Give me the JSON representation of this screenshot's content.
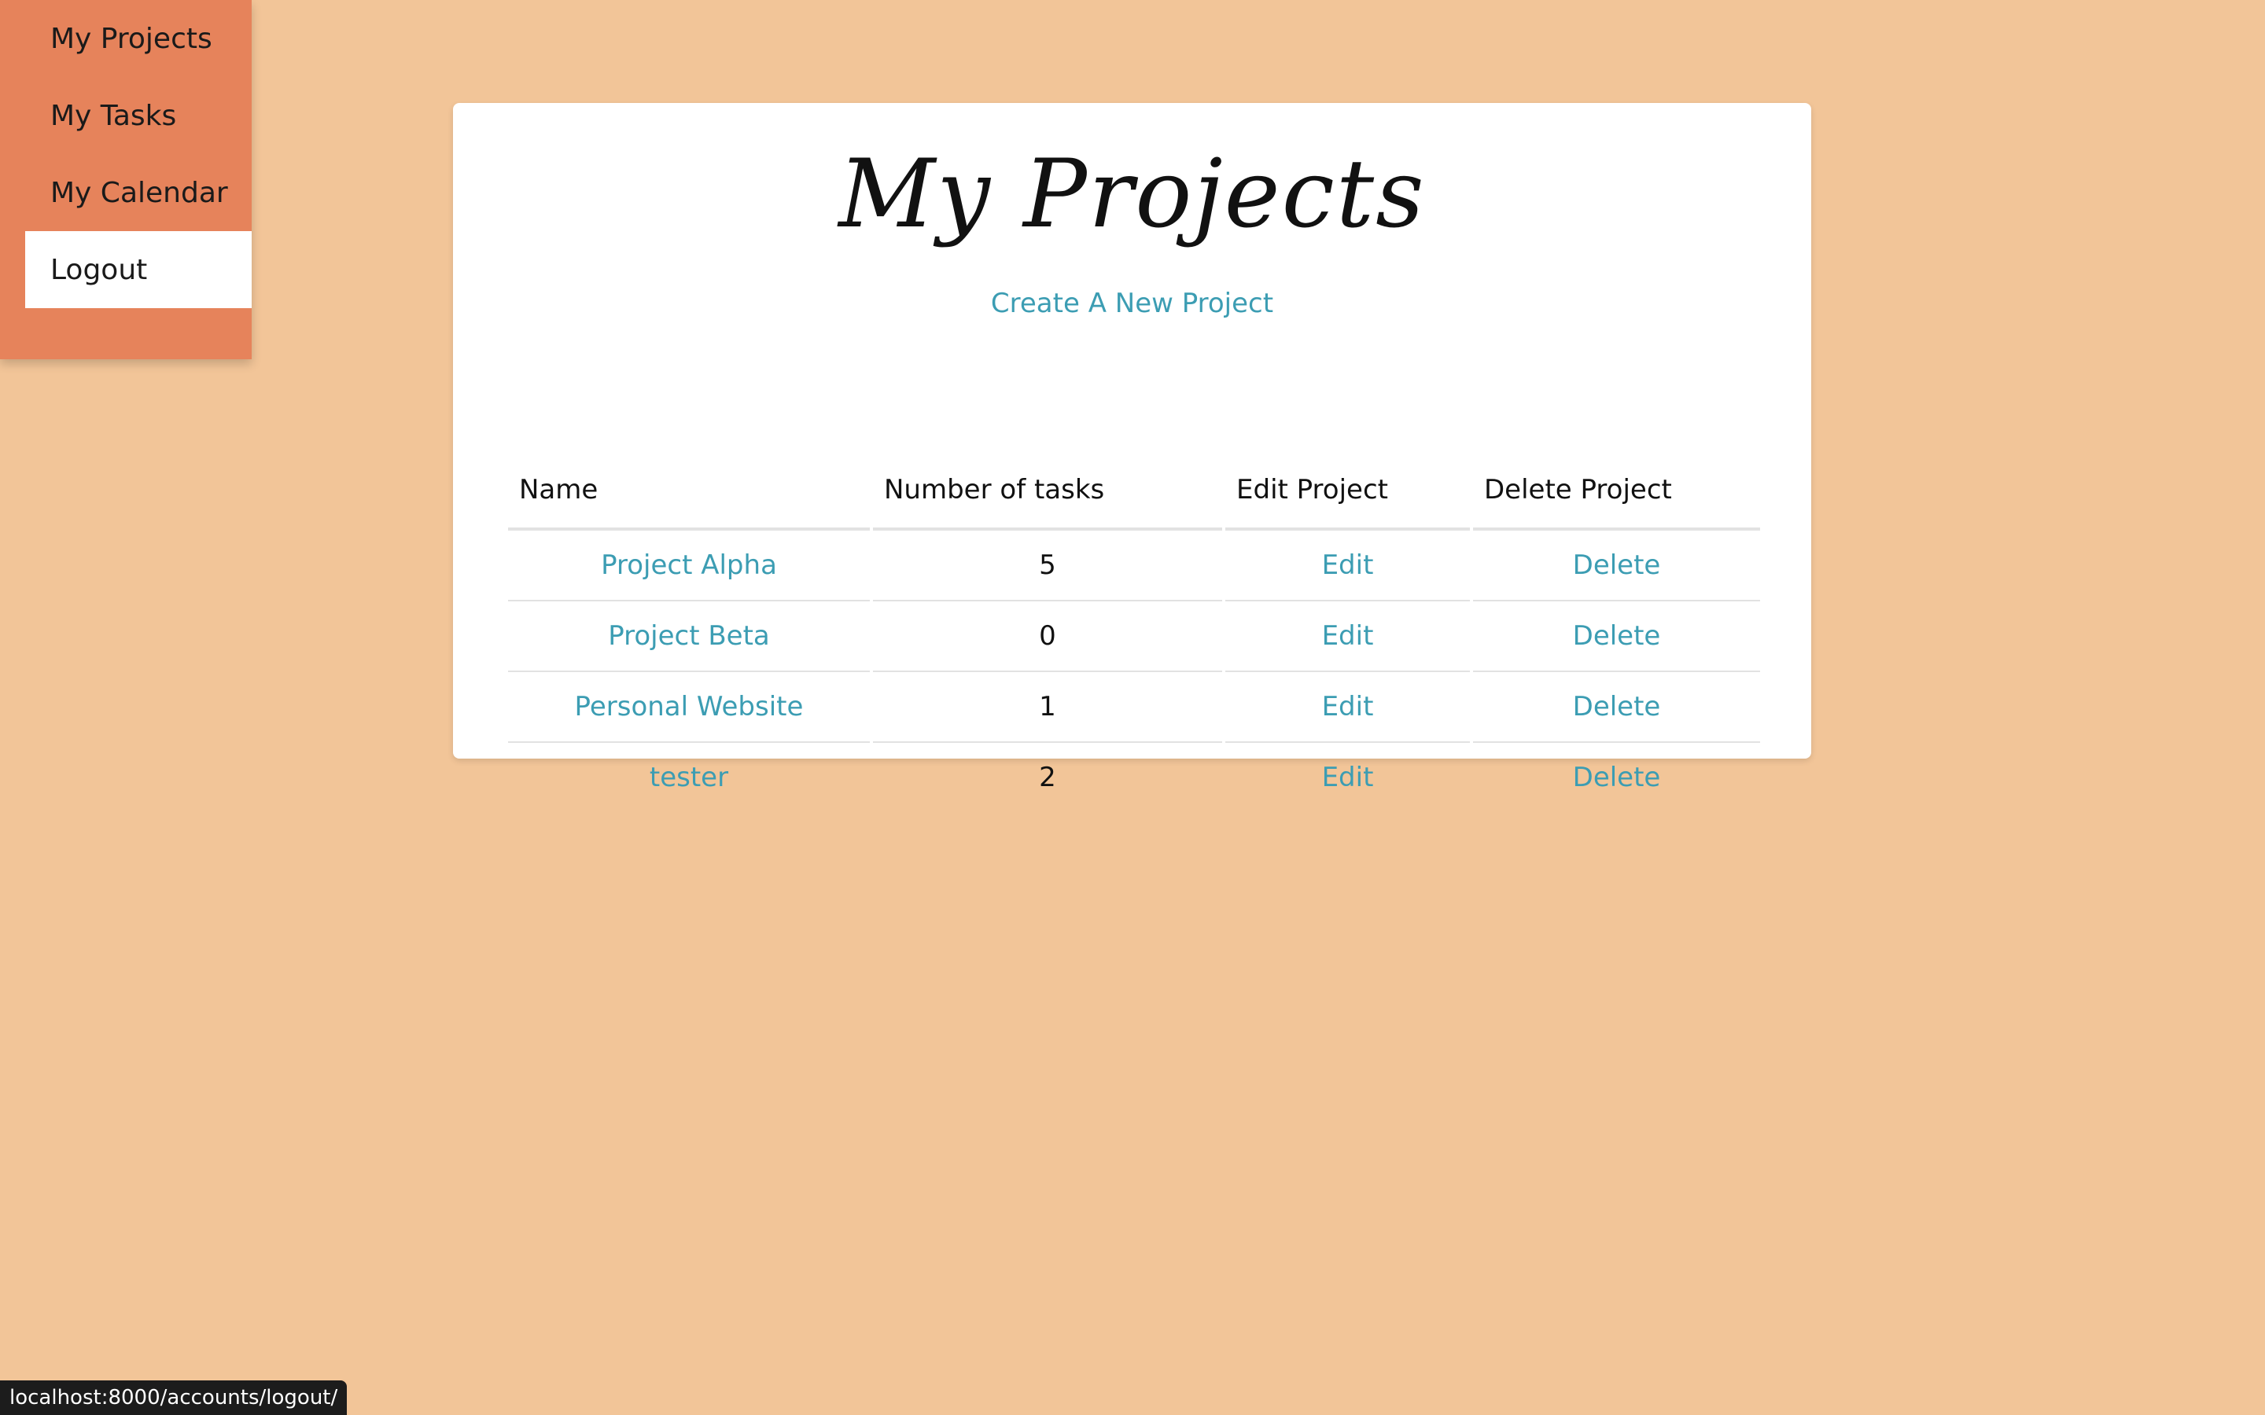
{
  "sidebar": {
    "items": [
      {
        "label": "My Projects"
      },
      {
        "label": "My Tasks"
      },
      {
        "label": "My Calendar"
      },
      {
        "label": "Logout"
      }
    ]
  },
  "main": {
    "title": "My Projects",
    "create_link": "Create A New Project",
    "table": {
      "headers": [
        "Name",
        "Number of tasks",
        "Edit Project",
        "Delete Project"
      ],
      "rows": [
        {
          "name": "Project Alpha",
          "tasks": "5",
          "edit": "Edit",
          "delete": "Delete"
        },
        {
          "name": "Project Beta",
          "tasks": "0",
          "edit": "Edit",
          "delete": "Delete"
        },
        {
          "name": "Personal Website",
          "tasks": "1",
          "edit": "Edit",
          "delete": "Delete"
        },
        {
          "name": "tester",
          "tasks": "2",
          "edit": "Edit",
          "delete": "Delete"
        }
      ]
    }
  },
  "status_bar": {
    "url": "localhost:8000/accounts/logout/"
  },
  "colors": {
    "page_background": "#f2c598",
    "sidebar_background": "#e6835b",
    "link": "#3c9db3"
  }
}
